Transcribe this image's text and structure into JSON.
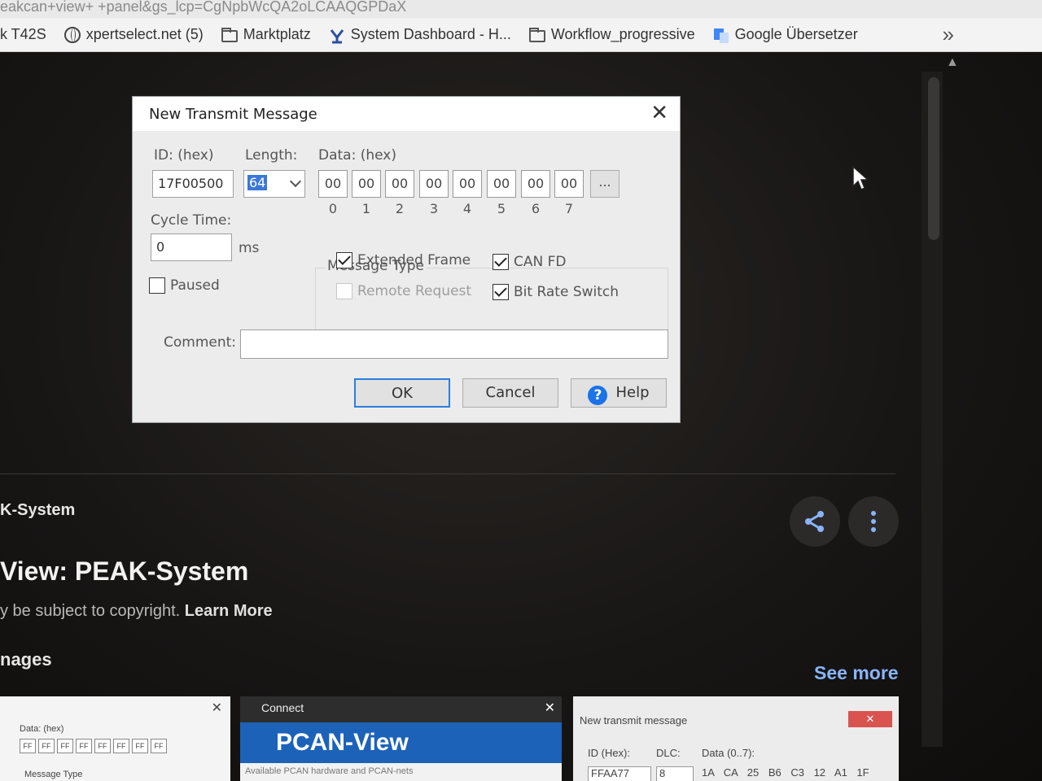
{
  "browser": {
    "url_fragment": "eakcan+view+ +panel&gs_lcp=CgNpbWcQA2oLCAAQGPDaX",
    "bookmarks": [
      {
        "label": "k T42S",
        "icon": "none"
      },
      {
        "label": "xpertselect.net (5)",
        "icon": "globe-icon"
      },
      {
        "label": "Marktplatz",
        "icon": "folder-icon"
      },
      {
        "label": "System Dashboard - H...",
        "icon": "app-icon"
      },
      {
        "label": "Workflow_progressive",
        "icon": "folder-icon"
      },
      {
        "label": "Google Übersetzer",
        "icon": "translate-icon"
      }
    ],
    "more_label": "»"
  },
  "result": {
    "source": "K-System",
    "title": "View: PEAK-System",
    "copyright_text": "y be subject to copyright.",
    "learn_more": "Learn More",
    "images_heading": "nages",
    "see_more": "See more"
  },
  "dialog": {
    "title": "New Transmit Message",
    "close": "✕",
    "id_label": "ID: (hex)",
    "id_value": "17F00500",
    "length_label": "Length:",
    "length_value": "64",
    "data_label": "Data: (hex)",
    "bytes": [
      "00",
      "00",
      "00",
      "00",
      "00",
      "00",
      "00",
      "00"
    ],
    "byte_indices": [
      "0",
      "1",
      "2",
      "3",
      "4",
      "5",
      "6",
      "7"
    ],
    "more_bytes": "...",
    "cycle_label": "Cycle Time:",
    "cycle_value": "0",
    "cycle_unit": "ms",
    "paused_label": "Paused",
    "msg_type_label": "Message Type",
    "extended_frame": "Extended Frame",
    "remote_request": "Remote Request",
    "can_fd": "CAN FD",
    "bit_rate_switch": "Bit Rate Switch",
    "comment_label": "Comment:",
    "comment_value": "",
    "ok": "OK",
    "cancel": "Cancel",
    "help": "Help"
  },
  "thumbs": {
    "t1_data_label": "Data: (hex)",
    "t1_msgtype": "Message Type",
    "t2_title": "Connect",
    "t2_brand": "PCAN-View",
    "t2_sub": "Available PCAN hardware and PCAN-nets",
    "t3_title": "New transmit message",
    "t3_id": "ID (Hex):",
    "t3_dlc": "DLC:",
    "t3_data": "Data (0..7):",
    "t3_id_val": "FFAA77",
    "t3_dlc_val": "8",
    "t3_bytes": "1A CA 25 B6 C3 12 A1 1F"
  }
}
